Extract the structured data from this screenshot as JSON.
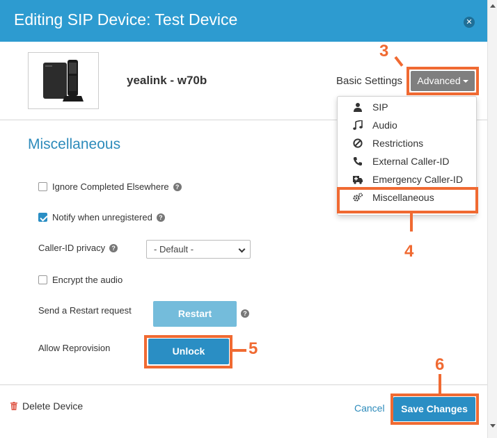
{
  "dialog": {
    "title": "Editing SIP Device: Test Device",
    "close_icon": "close-icon"
  },
  "device": {
    "name": "yealink - w70b"
  },
  "settings_tabs": {
    "basic_label": "Basic Settings",
    "advanced_label": "Advanced"
  },
  "advanced_menu": {
    "items": [
      {
        "label": "SIP",
        "icon": "user-icon"
      },
      {
        "label": "Audio",
        "icon": "music-note-icon"
      },
      {
        "label": "Restrictions",
        "icon": "ban-icon"
      },
      {
        "label": "External Caller-ID",
        "icon": "phone-icon"
      },
      {
        "label": "Emergency Caller-ID",
        "icon": "ambulance-icon"
      },
      {
        "label": "Miscellaneous",
        "icon": "gears-icon"
      }
    ]
  },
  "section": {
    "title": "Miscellaneous"
  },
  "form": {
    "ignore_completed": {
      "label": "Ignore Completed Elsewhere",
      "checked": false
    },
    "notify_unregistered": {
      "label": "Notify when unregistered",
      "checked": true
    },
    "caller_id_privacy": {
      "label": "Caller-ID privacy",
      "value": "- Default -"
    },
    "encrypt_audio": {
      "label": "Encrypt the audio",
      "checked": false
    },
    "restart": {
      "label": "Send a Restart request",
      "button": "Restart"
    },
    "reprovision": {
      "label": "Allow Reprovision",
      "button": "Unlock"
    }
  },
  "footer": {
    "delete_label": "Delete Device",
    "cancel_label": "Cancel",
    "save_label": "Save Changes"
  },
  "callouts": [
    "3",
    "4",
    "5",
    "6"
  ],
  "colors": {
    "header": "#2d9bd0",
    "primary_button": "#2a8ec4",
    "highlight": "#f06a32"
  }
}
